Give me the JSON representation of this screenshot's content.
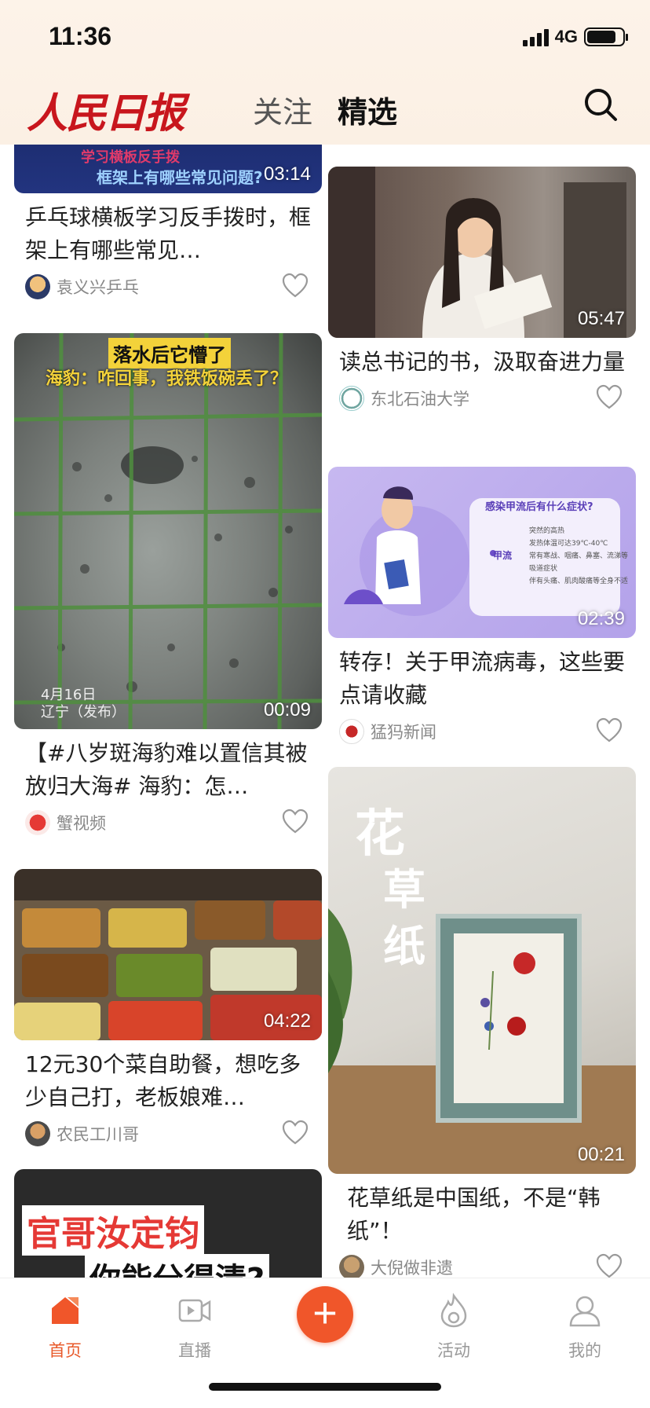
{
  "status": {
    "time": "11:36",
    "network": "4G"
  },
  "header": {
    "logo": "人民日报",
    "tabs": {
      "follow": "关注",
      "featured": "精选"
    }
  },
  "feed": {
    "left": [
      {
        "duration": "03:14",
        "overlay": [
          "学习横板反手拨",
          "框架上有哪些常见问题?"
        ],
        "title": "乒乓球横板学习反手拨时，框架上有哪些常见…",
        "author": "袁义兴乒乓"
      },
      {
        "duration": "00:09",
        "overlay": [
          "落水后它懵了",
          "海豹：咋回事，我铁饭碗丢了？",
          "4月16日",
          "辽宁（发布）"
        ],
        "title": "【#八岁斑海豹难以置信其被放归大海# 海豹：怎…",
        "author": "蟹视频"
      },
      {
        "duration": "04:22",
        "title": "12元30个菜自助餐，想吃多少自己打，老板娘难…",
        "author": "农民工川哥"
      },
      {
        "overlay": [
          "官哥汝定钧",
          "你能分得清?"
        ]
      }
    ],
    "right": [
      {
        "duration": "05:47",
        "title": "读总书记的书，汲取奋进力量",
        "author": "东北石油大学"
      },
      {
        "duration": "02:39",
        "overlay": [
          "感染甲流后有什么症状?",
          "甲流",
          "突然的高热",
          "发热体温可达39℃-40℃",
          "常有寒战、咽痛、鼻塞、流涕等",
          "吸道症状",
          "伴有头痛、肌肉酸痛等全身不适"
        ],
        "title": "转存！关于甲流病毒，这些要点请收藏",
        "author": "猛犸新闻"
      },
      {
        "duration": "00:21",
        "overlay": [
          "花",
          "草",
          "纸"
        ],
        "title": "花草纸是中国纸，不是“韩纸”！",
        "author": "大倪做非遗"
      }
    ]
  },
  "nav": {
    "home": "首页",
    "live": "直播",
    "add": "+",
    "activity": "活动",
    "mine": "我的"
  },
  "colors": {
    "accent": "#f0562a",
    "brand": "#c8161d"
  }
}
